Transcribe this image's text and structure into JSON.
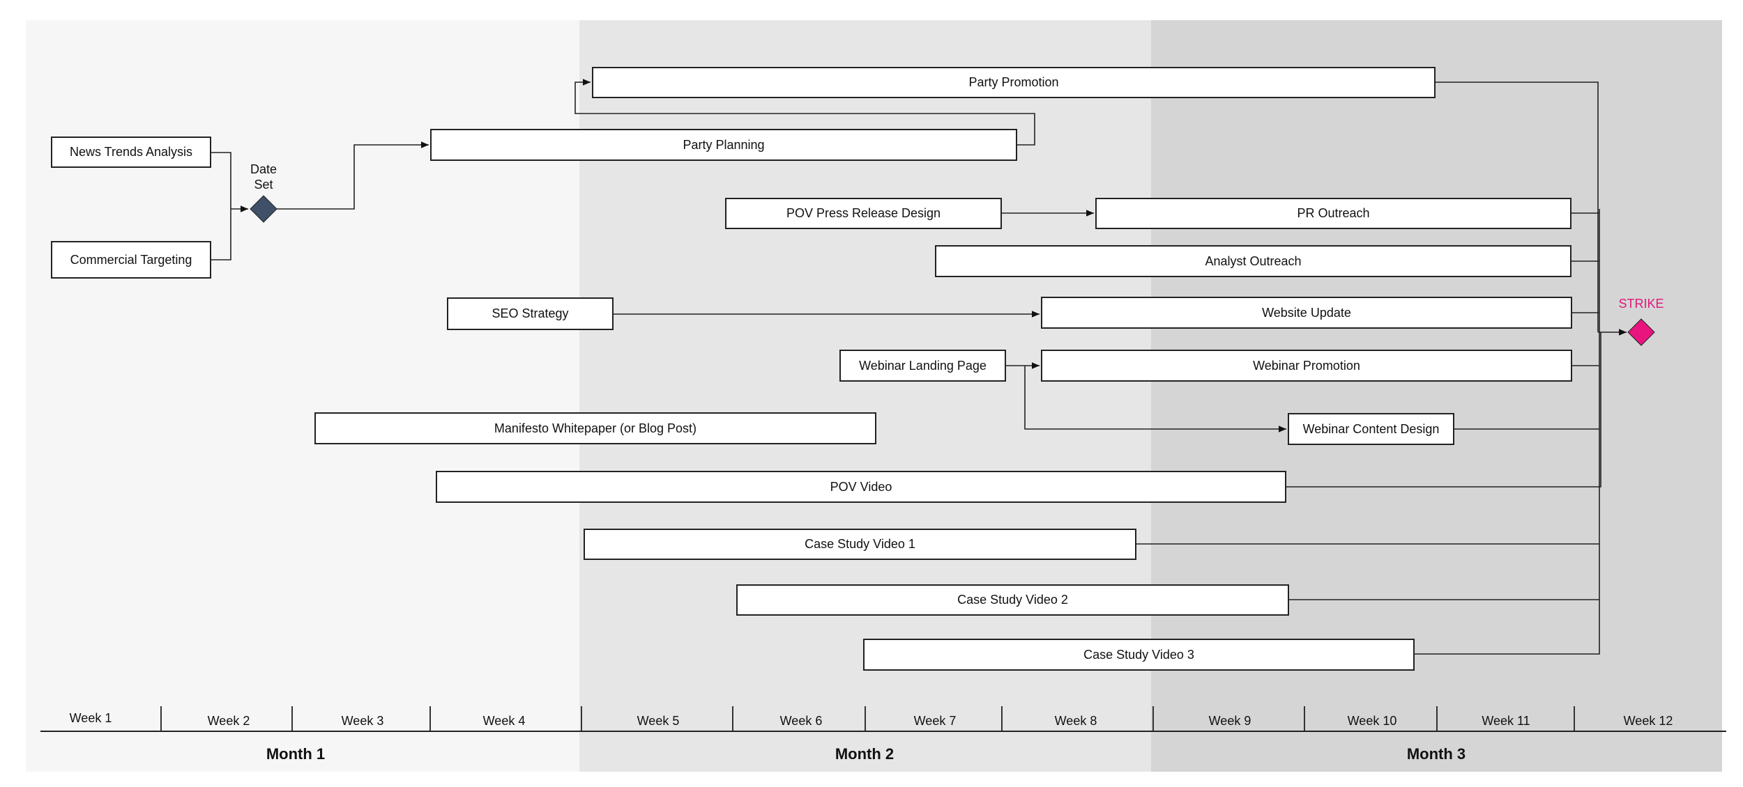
{
  "months": [
    {
      "label": "Month 1"
    },
    {
      "label": "Month 2"
    },
    {
      "label": "Month 3"
    }
  ],
  "weeks": [
    "Week 1",
    "Week 2",
    "Week 3",
    "Week 4",
    "Week 5",
    "Week 6",
    "Week 7",
    "Week 8",
    "Week 9",
    "Week 10",
    "Week 11",
    "Week 12"
  ],
  "milestones": {
    "date_set": {
      "label_line1": "Date",
      "label_line2": "Set",
      "color": "#3f5068"
    },
    "strike": {
      "label": "STRIKE",
      "color": "#e8157e"
    }
  },
  "tasks": {
    "news_trends": "News Trends Analysis",
    "commercial_targeting": "Commercial Targeting",
    "party_planning": "Party Planning",
    "party_promotion": "Party Promotion",
    "pov_press_release": "POV Press Release Design",
    "pr_outreach": "PR Outreach",
    "analyst_outreach": "Analyst Outreach",
    "seo_strategy": "SEO Strategy",
    "website_update": "Website Update",
    "webinar_landing": "Webinar Landing Page",
    "webinar_promotion": "Webinar Promotion",
    "webinar_content": "Webinar Content Design",
    "manifesto": "Manifesto Whitepaper (or Blog Post)",
    "pov_video": "POV Video",
    "case_study_1": "Case Study Video 1",
    "case_study_2": "Case Study Video 2",
    "case_study_3": "Case Study Video 3"
  }
}
